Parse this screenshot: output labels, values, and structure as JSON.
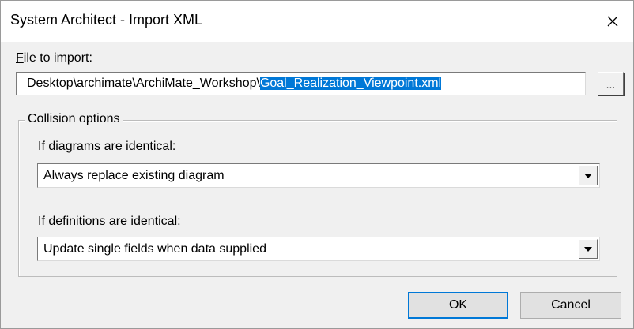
{
  "window": {
    "title": "System Architect - Import XML",
    "close_glyph": "×"
  },
  "file": {
    "label_accel": "F",
    "label_rest": "ile to import:",
    "path_prefix": "Desktop\\archimate\\ArchiMate_Workshop\\",
    "path_selected": "Goal_Realization_Viewpoint.xml",
    "browse_label": "..."
  },
  "collision": {
    "legend": "Collision options",
    "diagrams": {
      "label_pre": "If ",
      "label_accel": "d",
      "label_post": "iagrams are identical:",
      "selected": "Always replace existing diagram"
    },
    "definitions": {
      "label_pre": "If defi",
      "label_accel": "n",
      "label_post": "itions are identical:",
      "selected": "Update single fields when data supplied"
    }
  },
  "buttons": {
    "ok": "OK",
    "cancel": "Cancel"
  },
  "colors": {
    "selection": "#0078d7",
    "dialog_bg": "#f0f0f0"
  },
  "icons": {
    "close": "close-icon",
    "dropdown": "chevron-down-icon"
  }
}
